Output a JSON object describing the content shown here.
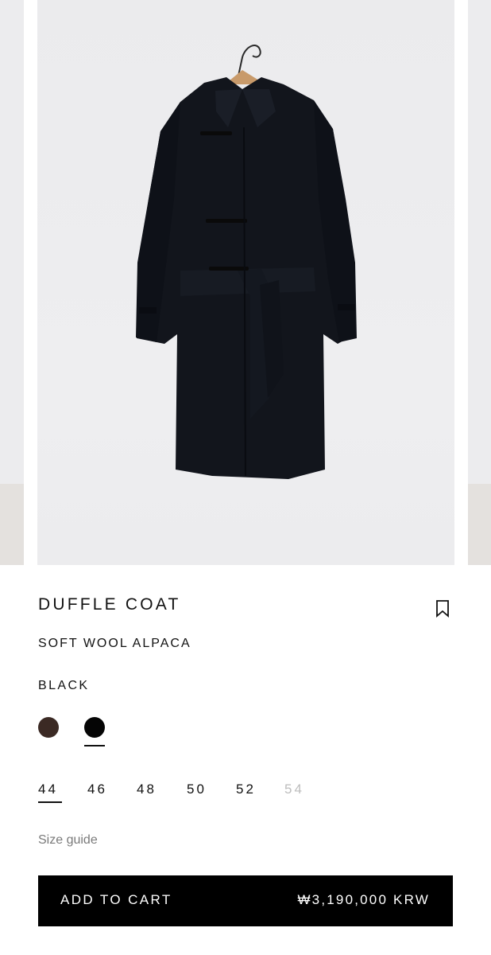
{
  "product": {
    "name": "DUFFLE COAT",
    "material": "SOFT WOOL ALPACA",
    "selected_color": "BLACK",
    "image_alt": "Black duffle coat on hanger"
  },
  "colors": [
    {
      "name": "brown-swatch",
      "hex": "#3b2a24",
      "selected": false
    },
    {
      "name": "black-swatch",
      "hex": "#050505",
      "selected": true
    }
  ],
  "sizes": [
    {
      "label": "44",
      "selected": true,
      "available": true
    },
    {
      "label": "46",
      "selected": false,
      "available": true
    },
    {
      "label": "48",
      "selected": false,
      "available": true
    },
    {
      "label": "50",
      "selected": false,
      "available": true
    },
    {
      "label": "52",
      "selected": false,
      "available": true
    },
    {
      "label": "54",
      "selected": false,
      "available": false
    }
  ],
  "size_guide": "Size guide",
  "cart": {
    "label": "ADD TO CART",
    "price": "₩3,190,000 KRW"
  },
  "icons": {
    "bookmark": "bookmark-icon"
  }
}
